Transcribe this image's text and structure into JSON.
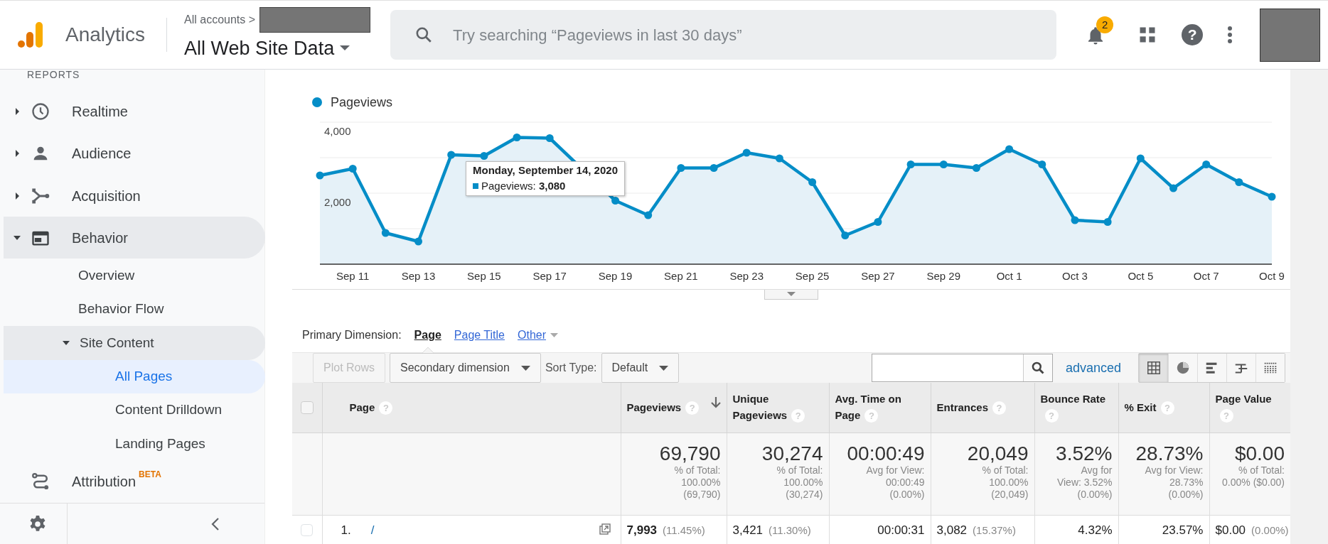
{
  "header": {
    "product": "Analytics",
    "breadcrumb": "All accounts >",
    "property": "All Web Site Data",
    "search": {
      "placeholder": "Try searching “Pageviews in last 30 days”"
    },
    "notifications": "2",
    "help": "?"
  },
  "sidebar": {
    "section": "REPORTS",
    "items": [
      {
        "label": "Realtime",
        "kind": "group",
        "expanded": false,
        "selected": false
      },
      {
        "label": "Audience",
        "kind": "group",
        "expanded": false,
        "selected": false
      },
      {
        "label": "Acquisition",
        "kind": "group",
        "expanded": false,
        "selected": false
      },
      {
        "label": "Behavior",
        "kind": "group",
        "expanded": true,
        "selected": false,
        "children": [
          {
            "label": "Overview",
            "kind": "link",
            "selected": false
          },
          {
            "label": "Behavior Flow",
            "kind": "link",
            "selected": false
          },
          {
            "label": "Site Content",
            "kind": "group",
            "expanded": true,
            "selected": false,
            "children": [
              {
                "label": "All Pages",
                "kind": "link",
                "selected": true
              },
              {
                "label": "Content Drilldown",
                "kind": "link",
                "selected": false
              },
              {
                "label": "Landing Pages",
                "kind": "link",
                "selected": false
              }
            ]
          }
        ]
      },
      {
        "label": "Attribution",
        "kind": "link",
        "selected": false,
        "badge": "BETA"
      }
    ]
  },
  "chart": {
    "chart_data": {
      "type": "area",
      "categories": [
        null,
        "Sep 11",
        null,
        "Sep 13",
        null,
        "Sep 15",
        null,
        "Sep 17",
        null,
        "Sep 19",
        null,
        "Sep 21",
        null,
        "Sep 23",
        null,
        "Sep 25",
        null,
        "Sep 27",
        null,
        "Sep 29",
        null,
        "Oct 1",
        null,
        "Oct 3",
        null,
        "Oct 5",
        null,
        "Oct 7",
        null,
        "Oct 9"
      ],
      "series": [
        {
          "name": "Pageviews",
          "color": "#058dc7",
          "values": [
            2500,
            2690,
            880,
            640,
            3080,
            3050,
            3570,
            3550,
            null,
            1790,
            1380,
            2710,
            2710,
            3140,
            2980,
            2310,
            810,
            1190,
            2810,
            2810,
            2710,
            3240,
            2810,
            1240,
            1190,
            2980,
            2140,
            2810,
            2310,
            1900
          ]
        }
      ],
      "ylim": [
        0,
        4000
      ],
      "yticks": [
        {
          "value": 2000,
          "label": "2,000"
        },
        {
          "value": 4000,
          "label": "4,000"
        }
      ]
    },
    "tooltip": {
      "title": "Monday, September 14, 2020",
      "text": "Pageviews: **3,080**"
    }
  },
  "dimension": {
    "label": "Primary Dimension:",
    "options": [
      {
        "label": "Page",
        "kind": "link",
        "selected": true
      },
      {
        "label": "Page Title",
        "kind": "link",
        "selected": false
      },
      {
        "label": "Other",
        "kind": "dropdown",
        "selected": false
      }
    ]
  },
  "toolbar": {
    "plot_rows": {
      "label": "Plot Rows",
      "disabled": true
    },
    "secondary": "Secondary dimension",
    "sort_label": "Sort Type:",
    "sort_value": "Default",
    "advanced": "advanced",
    "views": [
      {
        "selected": true
      },
      {
        "selected": false
      },
      {
        "selected": false
      },
      {
        "selected": false
      },
      {
        "selected": false
      }
    ]
  },
  "table": {
    "select_all": {
      "checked": false
    },
    "columns": [
      {
        "label": "Page",
        "help": "?",
        "sorted": false
      },
      {
        "label": "Pageviews",
        "help": "?",
        "sorted": true
      },
      {
        "label": "Unique Pageviews",
        "help": "?",
        "sorted": false
      },
      {
        "label": "Avg. Time on Page",
        "help": "?",
        "sorted": false
      },
      {
        "label": "Entrances",
        "help": "?",
        "sorted": false
      },
      {
        "label": "Bounce Rate",
        "help": "?",
        "sorted": false
      },
      {
        "label": "% Exit",
        "help": "?",
        "sorted": false
      },
      {
        "label": "Page Value",
        "help": "?",
        "sorted": false
      }
    ],
    "totals": [
      {
        "value": "69,790",
        "note": [
          "% of Total:",
          "100.00%",
          "(69,790)"
        ]
      },
      {
        "value": "30,274",
        "note": [
          "% of Total:",
          "100.00%",
          "(30,274)"
        ]
      },
      {
        "value": "00:00:49",
        "note": [
          "Avg for View:",
          "00:00:49",
          "(0.00%)"
        ]
      },
      {
        "value": "20,049",
        "note": [
          "% of Total:",
          "100.00%",
          "(20,049)"
        ]
      },
      {
        "value": "3.52%",
        "note": [
          "Avg for",
          "View: 3.52%",
          "(0.00%)"
        ]
      },
      {
        "value": "28.73%",
        "note": [
          "Avg for View:",
          "28.73%",
          "(0.00%)"
        ]
      },
      {
        "value": "$0.00",
        "note": [
          "% of Total:",
          "0.00% ($0.00)"
        ]
      }
    ],
    "rows": [
      {
        "checked": false,
        "cells": [
          {
            "number": "1.",
            "page": "/"
          },
          {
            "value": "7,993",
            "share": "(11.45%)"
          },
          {
            "value": "3,421",
            "share": "(11.30%)"
          },
          {
            "value": "00:00:31"
          },
          {
            "value": "3,082",
            "share": "(15.37%)"
          },
          {
            "value": "4.32%"
          },
          {
            "value": "23.57%"
          },
          {
            "value": "$0.00",
            "share": "(0.00%)"
          }
        ]
      }
    ]
  }
}
